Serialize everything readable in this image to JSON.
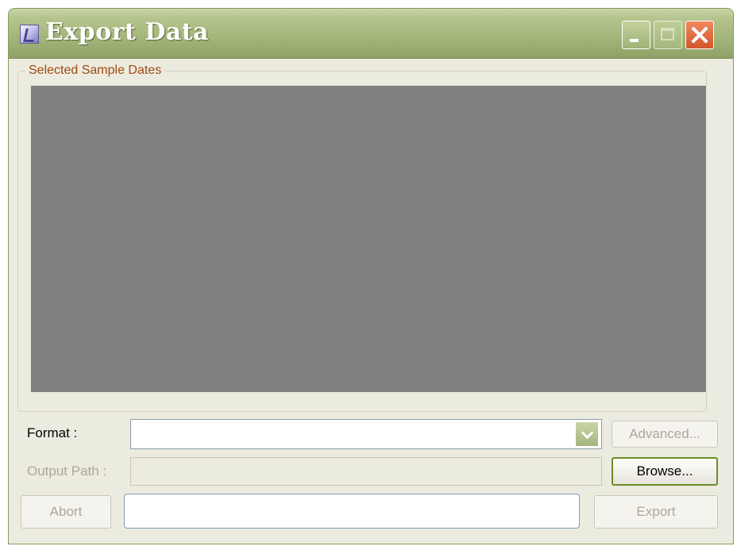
{
  "window": {
    "title": "Export Data",
    "icons": {
      "app": "app-icon",
      "minimize": "minimize-icon",
      "maximize": "maximize-icon",
      "close": "close-icon"
    }
  },
  "sample_dates": {
    "legend": "Selected Sample Dates",
    "items": []
  },
  "format": {
    "label": "Format :",
    "value": "",
    "dropdown_icon": "chevron-down-icon"
  },
  "output_path": {
    "label": "Output Path :",
    "value": ""
  },
  "buttons": {
    "advanced": "Advanced...",
    "browse": "Browse...",
    "abort": "Abort",
    "export": "Export"
  },
  "status": {
    "value": ""
  },
  "colors": {
    "titlebar": "#a3b57a",
    "window_bg": "#ecebdf",
    "legend_text": "#a04a10",
    "list_bg": "#808080",
    "disabled_text": "#aca899",
    "close_button": "#d2562c"
  }
}
